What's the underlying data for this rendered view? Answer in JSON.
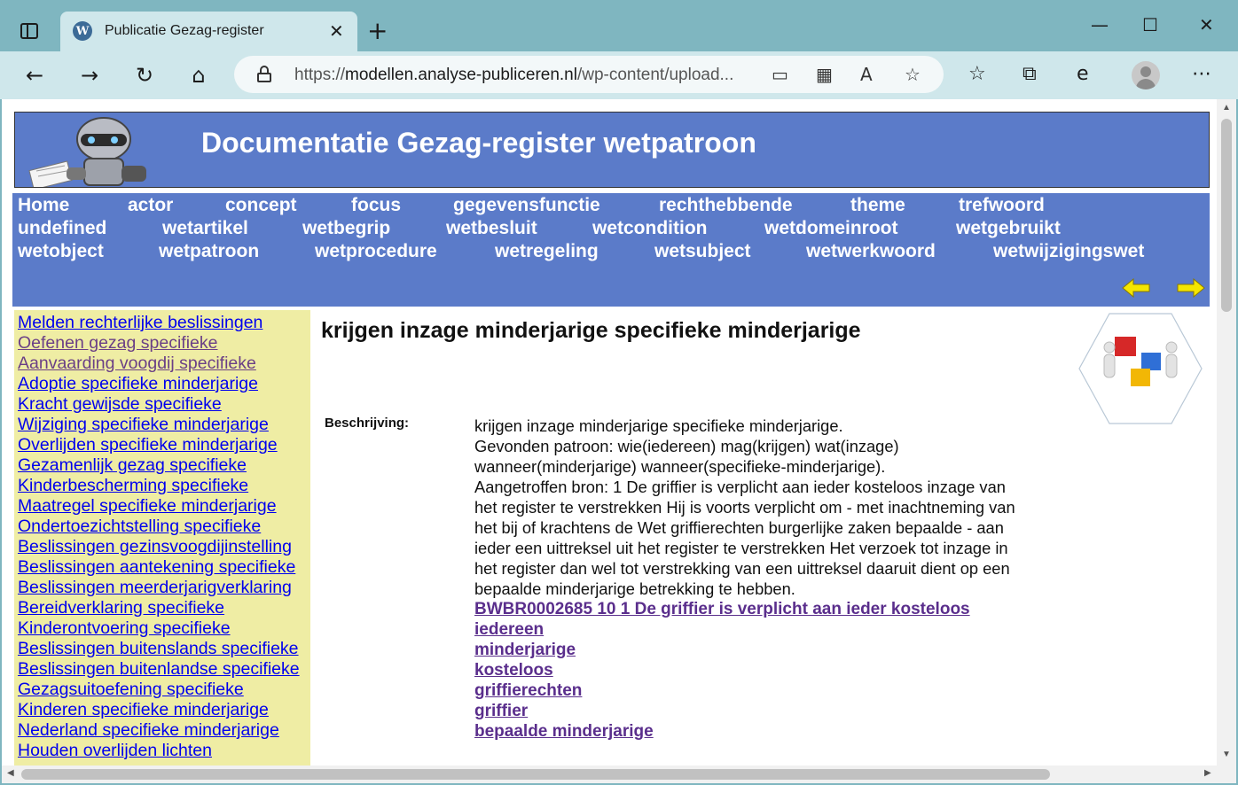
{
  "browser": {
    "tab_title": "Publicatie Gezag-register",
    "tab_close": "✕",
    "new_tab": "+",
    "url_prefix": "https://",
    "url_host": "modellen.analyse-publiceren.nl",
    "url_path": "/wp-content/upload...",
    "minimize": "—",
    "maximize": "☐",
    "close": "✕",
    "back": "←",
    "forward": "→",
    "reload": "↻",
    "home": "⌂",
    "more": "⋯"
  },
  "page": {
    "banner_title": "Documentatie Gezag-register wetpatroon",
    "menu_rows": [
      [
        "Home",
        "actor",
        "concept",
        "focus",
        "gegevensfunctie",
        "rechthebbende",
        "theme",
        "trefwoord"
      ],
      [
        "undefined",
        "wetartikel",
        "wetbegrip",
        "wetbesluit",
        "wetcondition",
        "wetdomeinroot",
        "wetgebruikt"
      ],
      [
        "wetobject",
        "wetpatroon",
        "wetprocedure",
        "wetregeling",
        "wetsubject",
        "wetwerkwoord",
        "wetwijzigingswet"
      ]
    ],
    "sidebar_links": [
      "Melden rechterlijke beslissingen",
      "Oefenen gezag specifieke",
      "Aanvaarding voogdij specifieke",
      "Adoptie specifieke minderjarige",
      "Kracht gewijsde specifieke",
      "Wijziging specifieke minderjarige",
      "Overlijden specifieke minderjarige",
      "Gezamenlijk gezag specifieke",
      "Kinderbescherming specifieke",
      "Maatregel specifieke minderjarige",
      "Ondertoezichtstelling specifieke",
      "Beslissingen gezinsvoogdijinstelling",
      "Beslissingen aantekening specifieke",
      "Beslissingen meerderjarigverklaring",
      "Bereidverklaring specifieke",
      "Kinderontvoering specifieke",
      "Beslissingen buitenslands specifieke",
      "Beslissingen buitenlandse specifieke",
      "Gezagsuitoefening specifieke",
      "Kinderen specifieke minderjarige",
      "Nederland specifieke minderjarige",
      "Houden overlijden lichten"
    ],
    "visited_links": [
      1,
      2
    ],
    "content_title": "krijgen inzage minderjarige specifieke minderjarige",
    "description_label": "Beschrijving:",
    "description_lines": [
      "krijgen inzage minderjarige specifieke minderjarige.",
      "Gevonden patroon: wie(iedereen) mag(krijgen) wat(inzage)",
      "wanneer(minderjarige) wanneer(specifieke-minderjarige).",
      "Aangetroffen bron: 1 De griffier is verplicht aan ieder kosteloos inzage van",
      "het register te verstrekken Hij is voorts verplicht om - met inachtneming van",
      "het bij of krachtens de Wet griffierechten burgerlijke zaken bepaalde - aan",
      "ieder een uittreksel uit het register te verstrekken Het verzoek tot inzage in",
      "het register dan wel tot verstrekking van een uittreksel daaruit dient op een",
      "bepaalde minderjarige betrekking te hebben."
    ],
    "content_links": [
      "BWBR0002685 10 1 De griffier is verplicht aan ieder kosteloos",
      "iedereen",
      "minderjarige",
      "kosteloos",
      "griffierechten",
      "griffier",
      "bepaalde minderjarige"
    ]
  },
  "colors": {
    "banner_blue": "#5b7bc9",
    "sidebar_yellow": "#efeda4",
    "link_blue": "#0000ee",
    "link_visited": "#6a3f86",
    "content_link": "#5a2e8c"
  }
}
